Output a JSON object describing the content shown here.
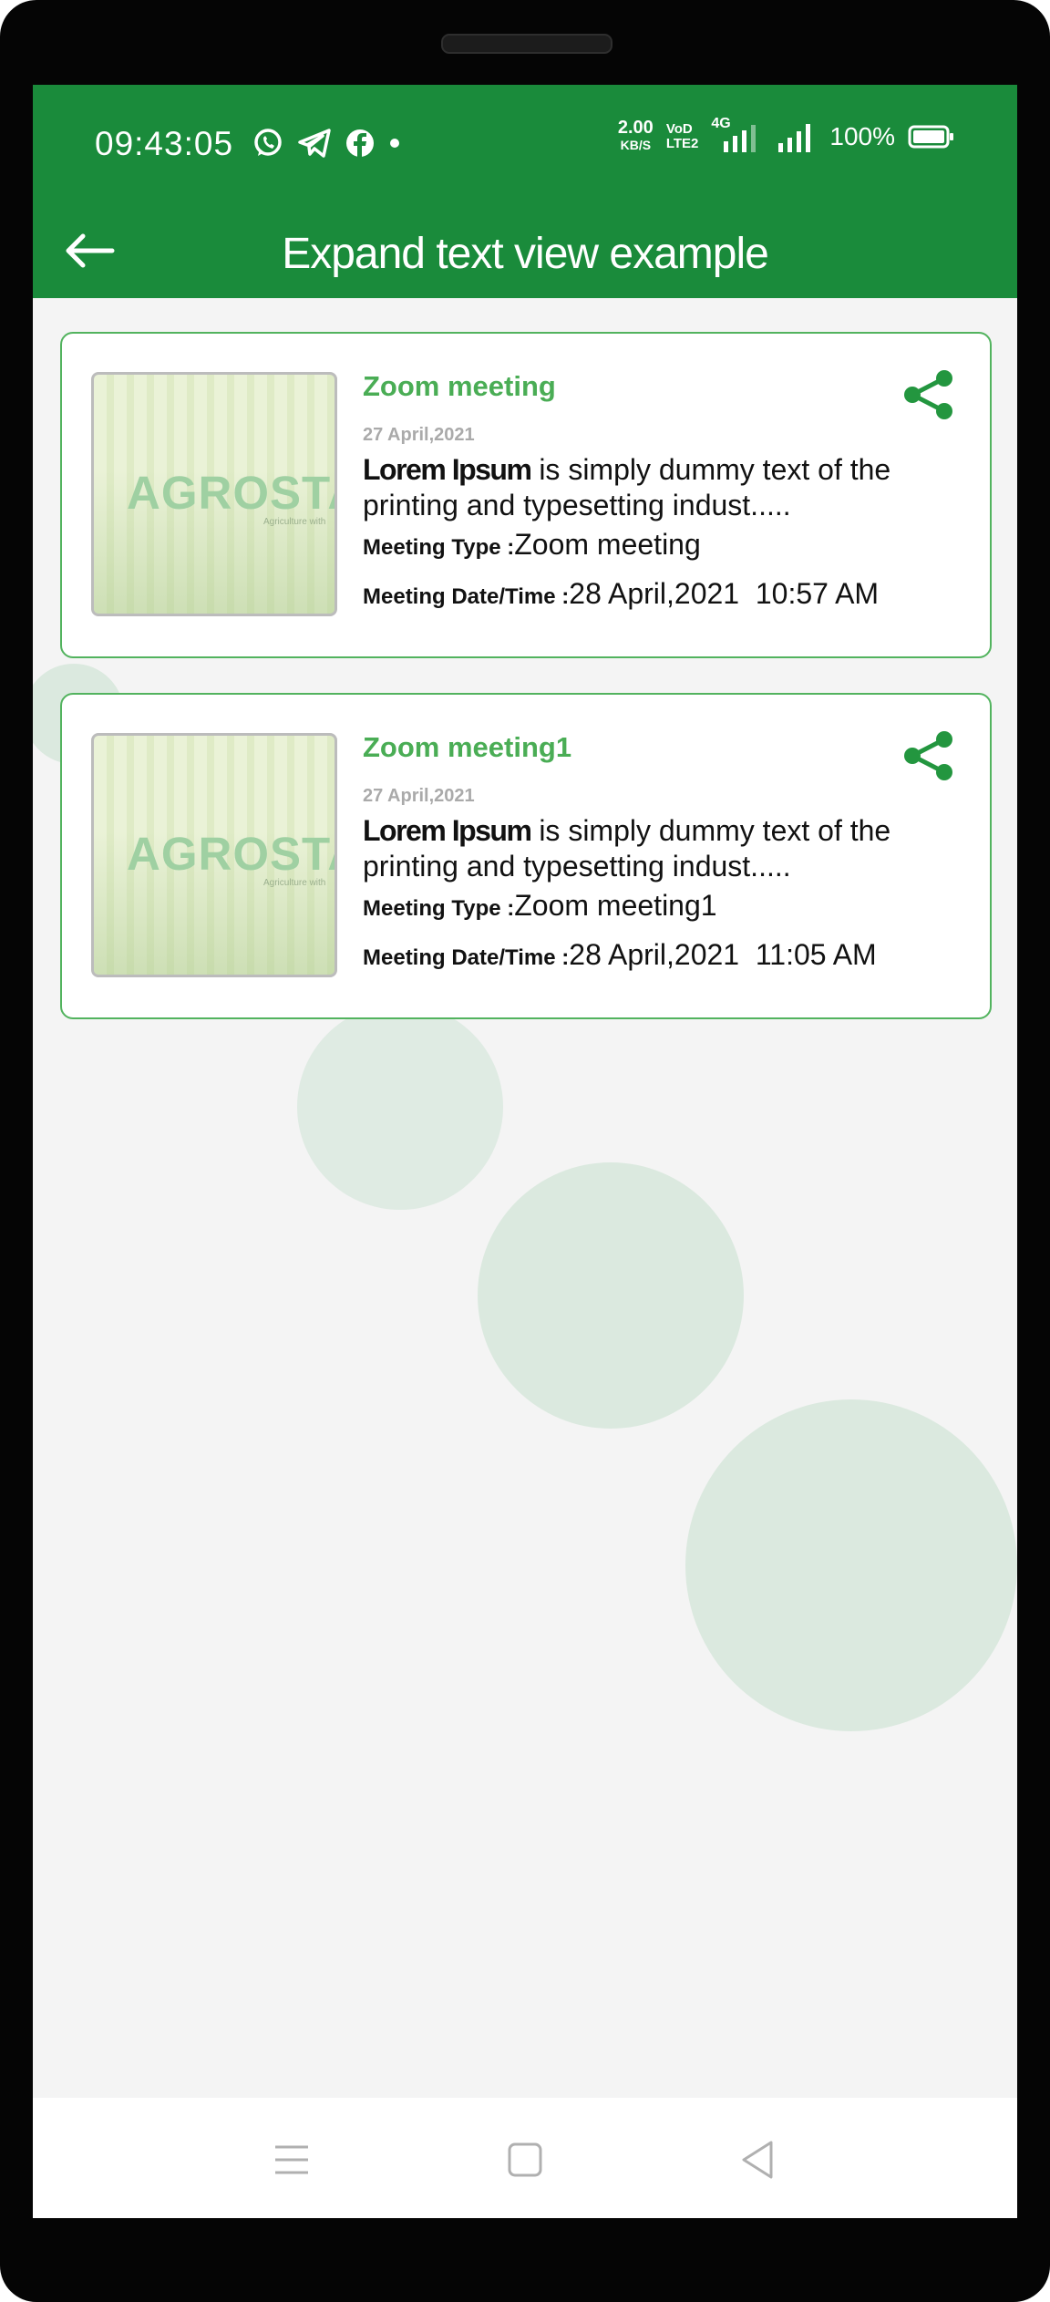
{
  "status_bar": {
    "time": "09:43:05",
    "net_speed_value": "2.00",
    "net_speed_unit": "KB/S",
    "volte_top": "VoD",
    "volte_bottom": "LTE2",
    "network_type": "4G",
    "battery": "100%",
    "app_icons": [
      "whatsapp-icon",
      "telegram-icon",
      "facebook-icon",
      "dot-icon"
    ]
  },
  "app_bar": {
    "title": "Expand text view example",
    "back_icon": "arrow-left-icon"
  },
  "meetings": [
    {
      "title": "Zoom meeting",
      "date": "27 April,2021",
      "desc_bold": "Lorem Ipsum",
      "desc_rest": " is simply dummy text of the printing and typesetting indust.....",
      "type_label": "Meeting Type :",
      "type_value": "Zoom meeting",
      "datetime_label": "Meeting Date/Time :",
      "datetime_value": "28 April,2021  10:57 AM",
      "thumb_logo": "AGROSTAR",
      "thumb_tagline": "Agriculture with"
    },
    {
      "title": "Zoom meeting1",
      "date": "27 April,2021",
      "desc_bold": "Lorem Ipsum",
      "desc_rest": " is simply dummy text of the printing and typesetting indust.....",
      "type_label": "Meeting Type :",
      "type_value": "Zoom meeting1",
      "datetime_label": "Meeting Date/Time :",
      "datetime_value": "28 April,2021  11:05 AM",
      "thumb_logo": "AGROSTAR",
      "thumb_tagline": "Agriculture with"
    }
  ],
  "colors": {
    "primary": "#1a8b3b",
    "accent": "#4aad55",
    "card_border": "#52b35e",
    "background": "#f4f4f4",
    "bubble": "#dbe9df"
  },
  "nav_bar": {
    "icons": [
      "menu-icon",
      "home-square-icon",
      "back-triangle-icon"
    ]
  }
}
